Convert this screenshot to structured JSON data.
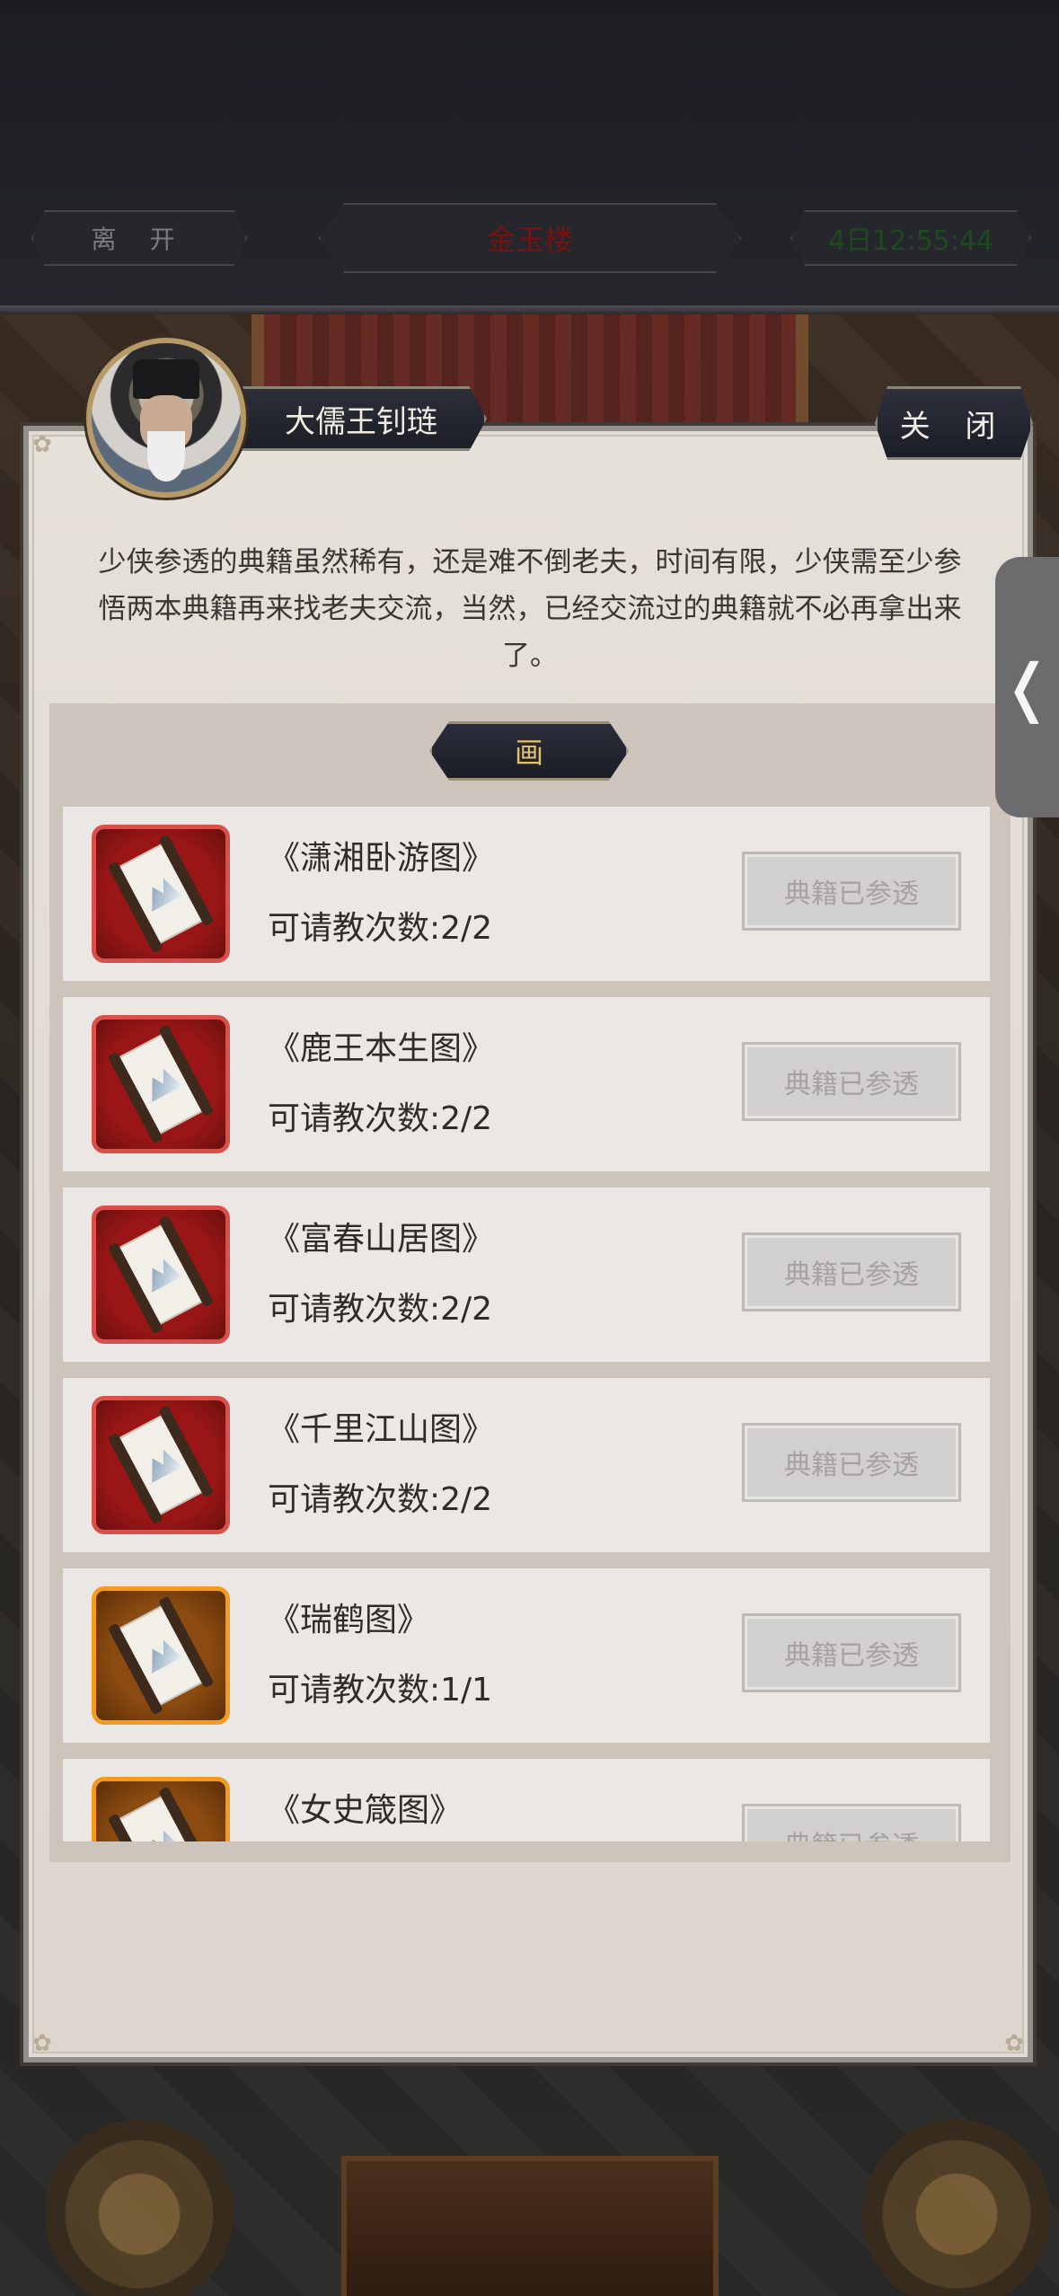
{
  "nav": {
    "leave_label": "离 开",
    "location_label": "金玉楼",
    "time_label": "4日12:55:44"
  },
  "npc": {
    "name": "大儒王钊琏",
    "avatar_icon": "scholar-portrait-icon"
  },
  "close_label": "关 闭",
  "side_tab_icon": "chevron-left-icon",
  "side_tab_glyph": "❬",
  "intro_text": "少侠参透的典籍虽然稀有，还是难不倒老夫，时间有限，少侠需至少参悟两本典籍再来找老夫交流，当然，已经交流过的典籍就不必再拿出来了。",
  "category_label": "画",
  "items": [
    {
      "title": "《潇湘卧游图》",
      "count": "可请教次数:2/2",
      "button": "典籍已参透",
      "rarity": "red"
    },
    {
      "title": "《鹿王本生图》",
      "count": "可请教次数:2/2",
      "button": "典籍已参透",
      "rarity": "red"
    },
    {
      "title": "《富春山居图》",
      "count": "可请教次数:2/2",
      "button": "典籍已参透",
      "rarity": "red"
    },
    {
      "title": "《千里江山图》",
      "count": "可请教次数:2/2",
      "button": "典籍已参透",
      "rarity": "red"
    },
    {
      "title": "《瑞鹤图》",
      "count": "可请教次数:1/1",
      "button": "典籍已参透",
      "rarity": "orange"
    },
    {
      "title": "《女史箴图》",
      "count": "",
      "button": "典籍已参透",
      "rarity": "orange"
    }
  ],
  "colors": {
    "panel_bg": "#e2dcd6",
    "button_disabled_bg": "#d2d0ce",
    "rarity_red": "#d9504a",
    "rarity_orange": "#f29b1e",
    "category_text": "#e3c06c"
  }
}
